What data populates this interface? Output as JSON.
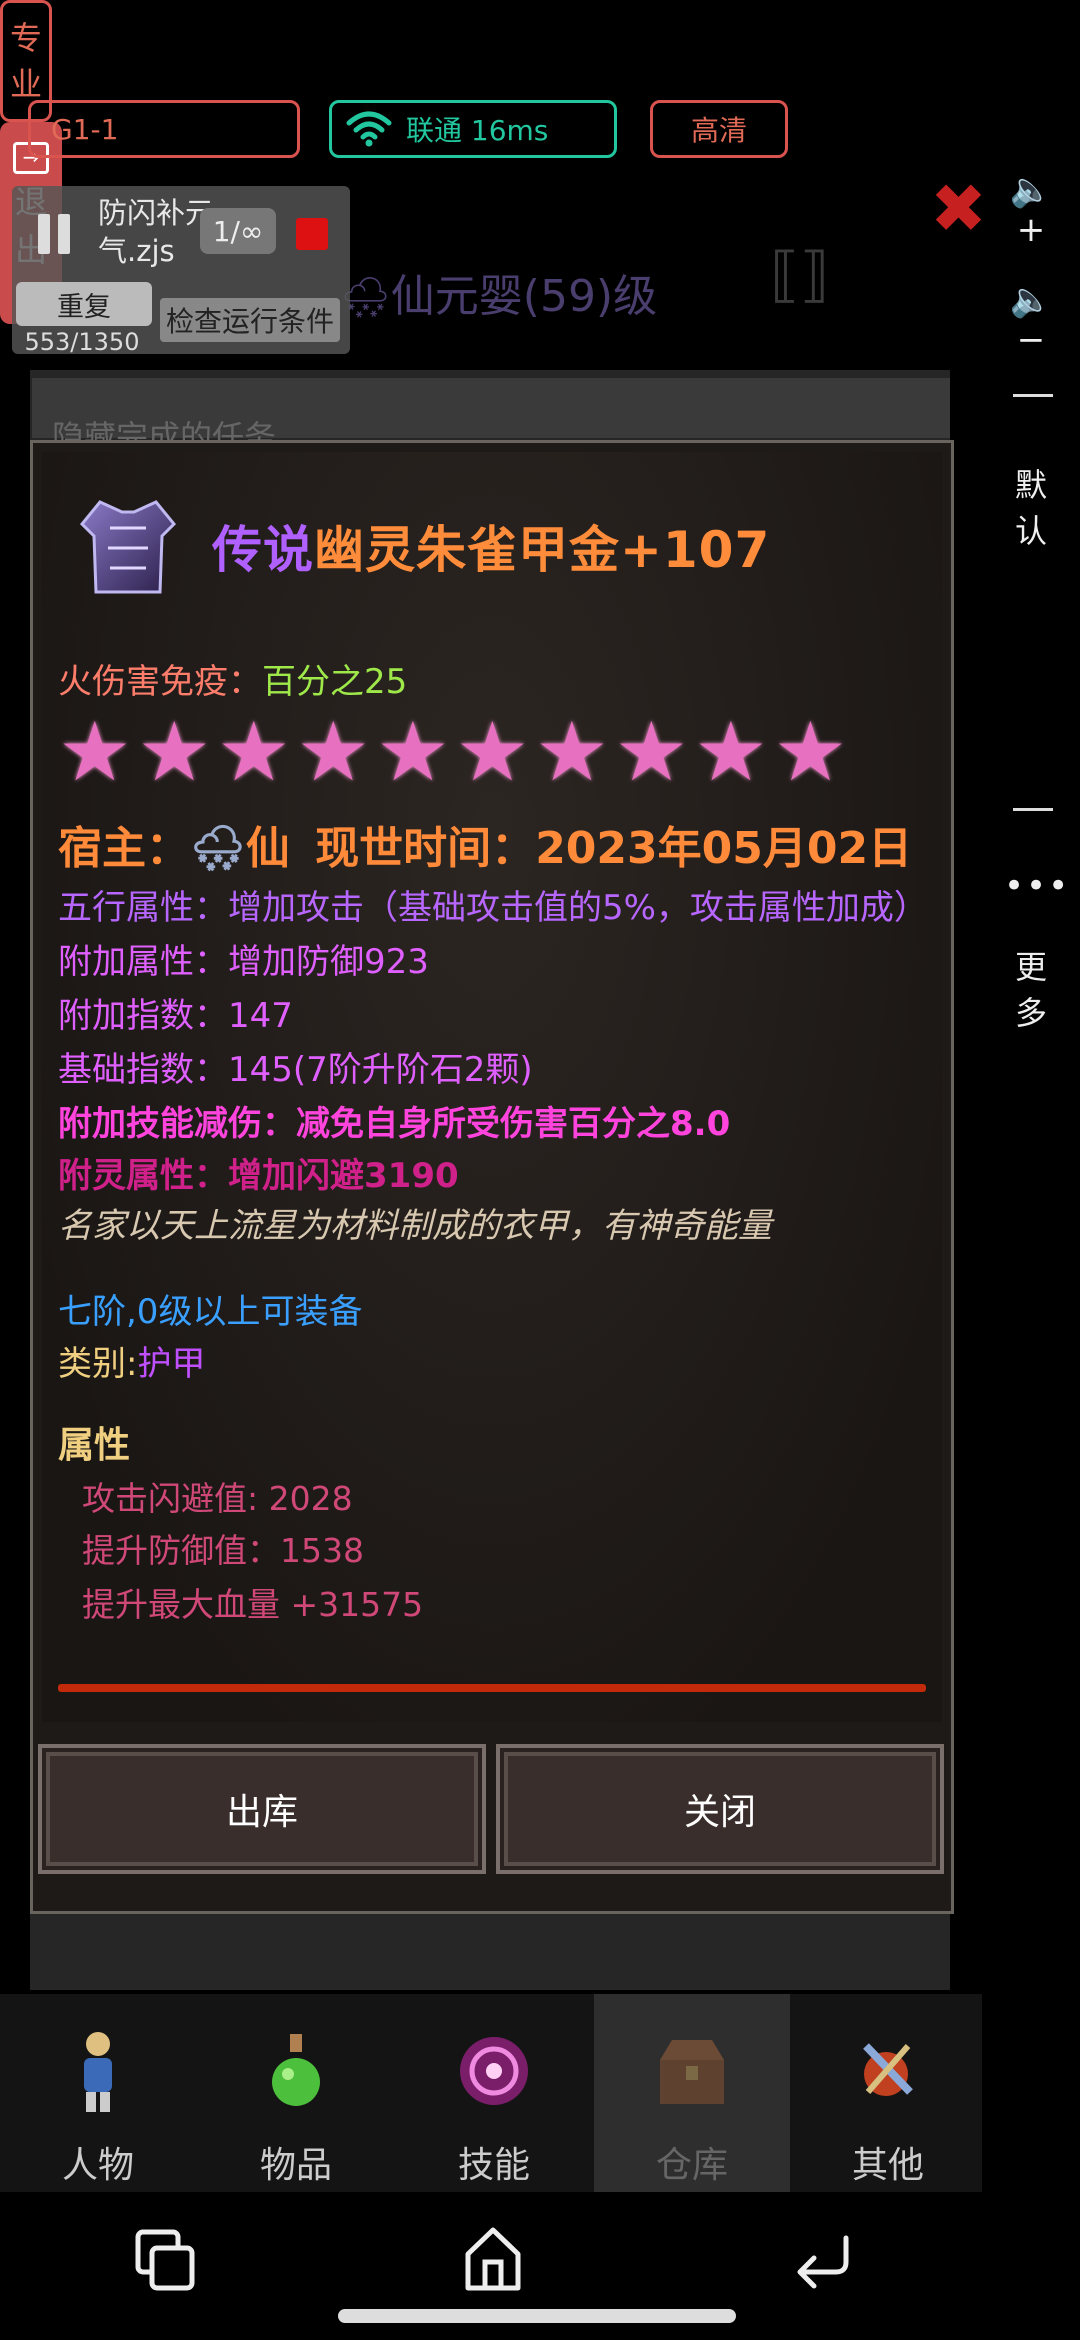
{
  "status": {
    "server": "G1-1",
    "network": "联通 16ms",
    "quality": "高清"
  },
  "script": {
    "name": "防闪补元气.zjs",
    "loop": "1/∞",
    "repeat_label": "重复",
    "count": "553/1350",
    "check_label": "检查运行条件"
  },
  "background": {
    "player_title": "仙元婴(59)级",
    "strip_text": "隐藏完成的任务"
  },
  "right_toolbar": {
    "default_label": "默认",
    "pro_label": "专业",
    "more_label": "更多",
    "exit_label": "退出"
  },
  "item": {
    "title_prefix": "传说",
    "title_name": "幽灵朱雀甲金+107",
    "immunity_label": "火伤害免疫：",
    "immunity_value": "百分之25",
    "stars": 10,
    "owner_label": "宿主：",
    "owner_name": "仙",
    "time_label": "现世时间：",
    "time_value": "2023年05月02日",
    "wuxing": "五行属性：增加攻击（基础攻击值的5%，攻击属性加成）",
    "extra_attr": "附加属性：增加防御923",
    "extra_index": "附加指数：147",
    "base_index": "基础指数：145(7阶升阶石2颗)",
    "skill_reduction": "附加技能减伤：减免自身所受伤害百分之8.0",
    "spirit_attr": "附灵属性：增加闪避3190",
    "description": "名家以天上流星为材料制成的衣甲，有神奇能量",
    "equip_req": "七阶,0级以上可装备",
    "category_label": "类别:",
    "category_value": "护甲",
    "props_header": "属性",
    "props": [
      "攻击闪避值: 2028",
      "提升防御值：1538",
      "提升最大血量 +31575"
    ]
  },
  "dialog_buttons": {
    "withdraw": "出库",
    "close": "关闭"
  },
  "tabs": [
    {
      "label": "人物"
    },
    {
      "label": "物品"
    },
    {
      "label": "技能"
    },
    {
      "label": "仓库"
    },
    {
      "label": "其他"
    }
  ],
  "colors": {
    "accent_red": "#d9534f",
    "network_green": "#22c7a0",
    "star_pink": "#e870c0"
  }
}
